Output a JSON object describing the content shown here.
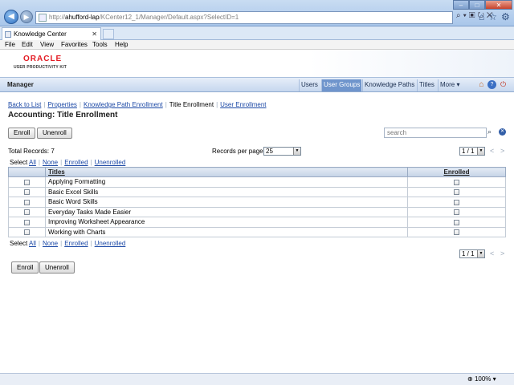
{
  "browser": {
    "url_prefix": "http://",
    "url_host": "ahufford-lap",
    "url_path": "/KCenter12_1/Manager/Default.aspx?SelectID=1",
    "tab_title": "Knowledge Center",
    "menu": [
      "File",
      "Edit",
      "View",
      "Favorites",
      "Tools",
      "Help"
    ],
    "zoom": "100%"
  },
  "banner": {
    "logo_brand": "ORACLE",
    "logo_product": "USER PRODUCTIVITY KIT"
  },
  "manager": {
    "title": "Manager",
    "tabs": [
      "Users",
      "User Groups",
      "Knowledge Paths",
      "Titles",
      "More"
    ]
  },
  "breadcrumbs": [
    "Back to List",
    "Properties",
    "Knowledge Path Enrollment",
    "Title Enrollment",
    "User Enrollment"
  ],
  "page_title": "Accounting: Title Enrollment",
  "actions": {
    "enroll": "Enroll",
    "unenroll": "Unenroll"
  },
  "search": {
    "placeholder": "search"
  },
  "toolbar": {
    "total_records": "Total Records: 7",
    "records_per_page_label": "Records per page:",
    "records_per_page_value": "25",
    "page_indicator": "1 / 1"
  },
  "select": {
    "label": "Select",
    "options": [
      "All",
      "None",
      "Enrolled",
      "Unenrolled"
    ]
  },
  "table": {
    "headers": [
      "Titles",
      "Enrolled"
    ],
    "rows": [
      "Applying Formatting",
      "Basic Excel Skills",
      "Basic Word Skills",
      "Everyday Tasks Made Easier",
      "Improving Worksheet Appearance",
      "Working with Charts"
    ]
  }
}
